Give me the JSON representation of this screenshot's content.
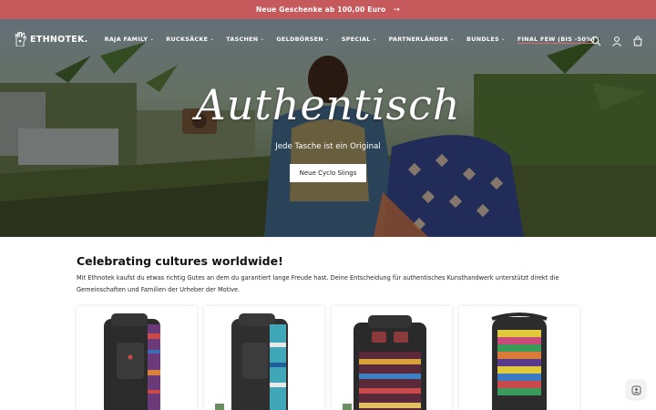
{
  "announcement": {
    "text": "Neue Geschenke ab 100,00 Euro",
    "arrow": "→"
  },
  "header": {
    "logo_text": "ETHNOTEK.",
    "nav": [
      {
        "label": "RAJA FAMILY",
        "has_dropdown": true
      },
      {
        "label": "RUCKSÄCKE",
        "has_dropdown": true
      },
      {
        "label": "TASCHEN",
        "has_dropdown": true
      },
      {
        "label": "GELDBÖRSEN",
        "has_dropdown": true
      },
      {
        "label": "SPECIAL",
        "has_dropdown": true
      },
      {
        "label": "PARTNERLÄNDER",
        "has_dropdown": true
      },
      {
        "label": "BUNDLES",
        "has_dropdown": true
      },
      {
        "label": "FINAL FEW (BIS -50%)",
        "has_dropdown": false
      }
    ],
    "icons": [
      "search-icon",
      "account-icon",
      "cart-icon"
    ]
  },
  "hero": {
    "title": "Authentisch",
    "subtitle": "Jede Tasche ist ein Original",
    "button_label": "Neue Cyclo Slings"
  },
  "section": {
    "heading": "Celebrating cultures worldwide!",
    "intro": "Mit Ethnotek kaufst du etwas richtig Gutes an dem du garantiert lange Freude hast. Deine Entscheidung für authentisches Kunsthandwerk unterstützt direkt die Gemeinschaften und Familien der Urheber der Motive."
  },
  "colors": {
    "announcement_bg": "#c5595c",
    "badge_bg": "#6b8f63",
    "sale_underline": "#e06a6e"
  }
}
